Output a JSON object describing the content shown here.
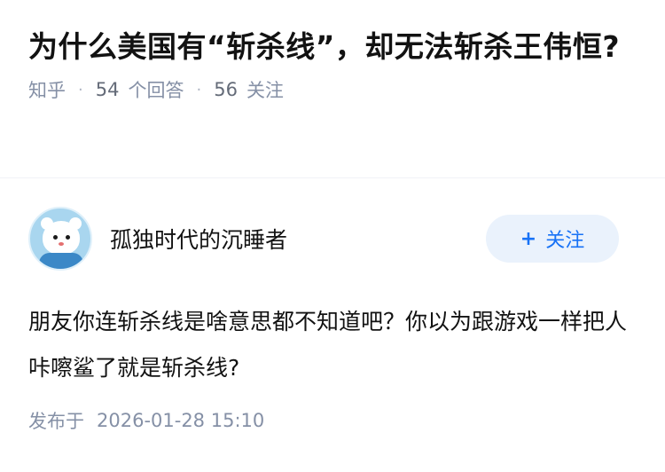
{
  "question": {
    "title": "为什么美国有“斩杀线”，却无法斩杀王伟恒?",
    "source": "知乎",
    "answer_count": "54",
    "answer_unit": "个回答",
    "follow_count": "56",
    "follow_unit": "关注",
    "separator": "·"
  },
  "answer": {
    "author_name": "孤独时代的沉睡者",
    "follow_button_plus": "+",
    "follow_button_label": "关注",
    "content": "朋友你连斩杀线是啥意思都不知道吧？你以为跟游戏一样把人咔嚓鲨了就是斩杀线?",
    "publish_label": "发布于",
    "publish_time": "2026-01-28 15:10"
  },
  "colors": {
    "accent": "#1772f6",
    "follow_bg": "#eaf2fc",
    "meta_text": "#8590a6"
  },
  "icons": {
    "avatar": "cartoon-dog-astronaut-avatar"
  }
}
